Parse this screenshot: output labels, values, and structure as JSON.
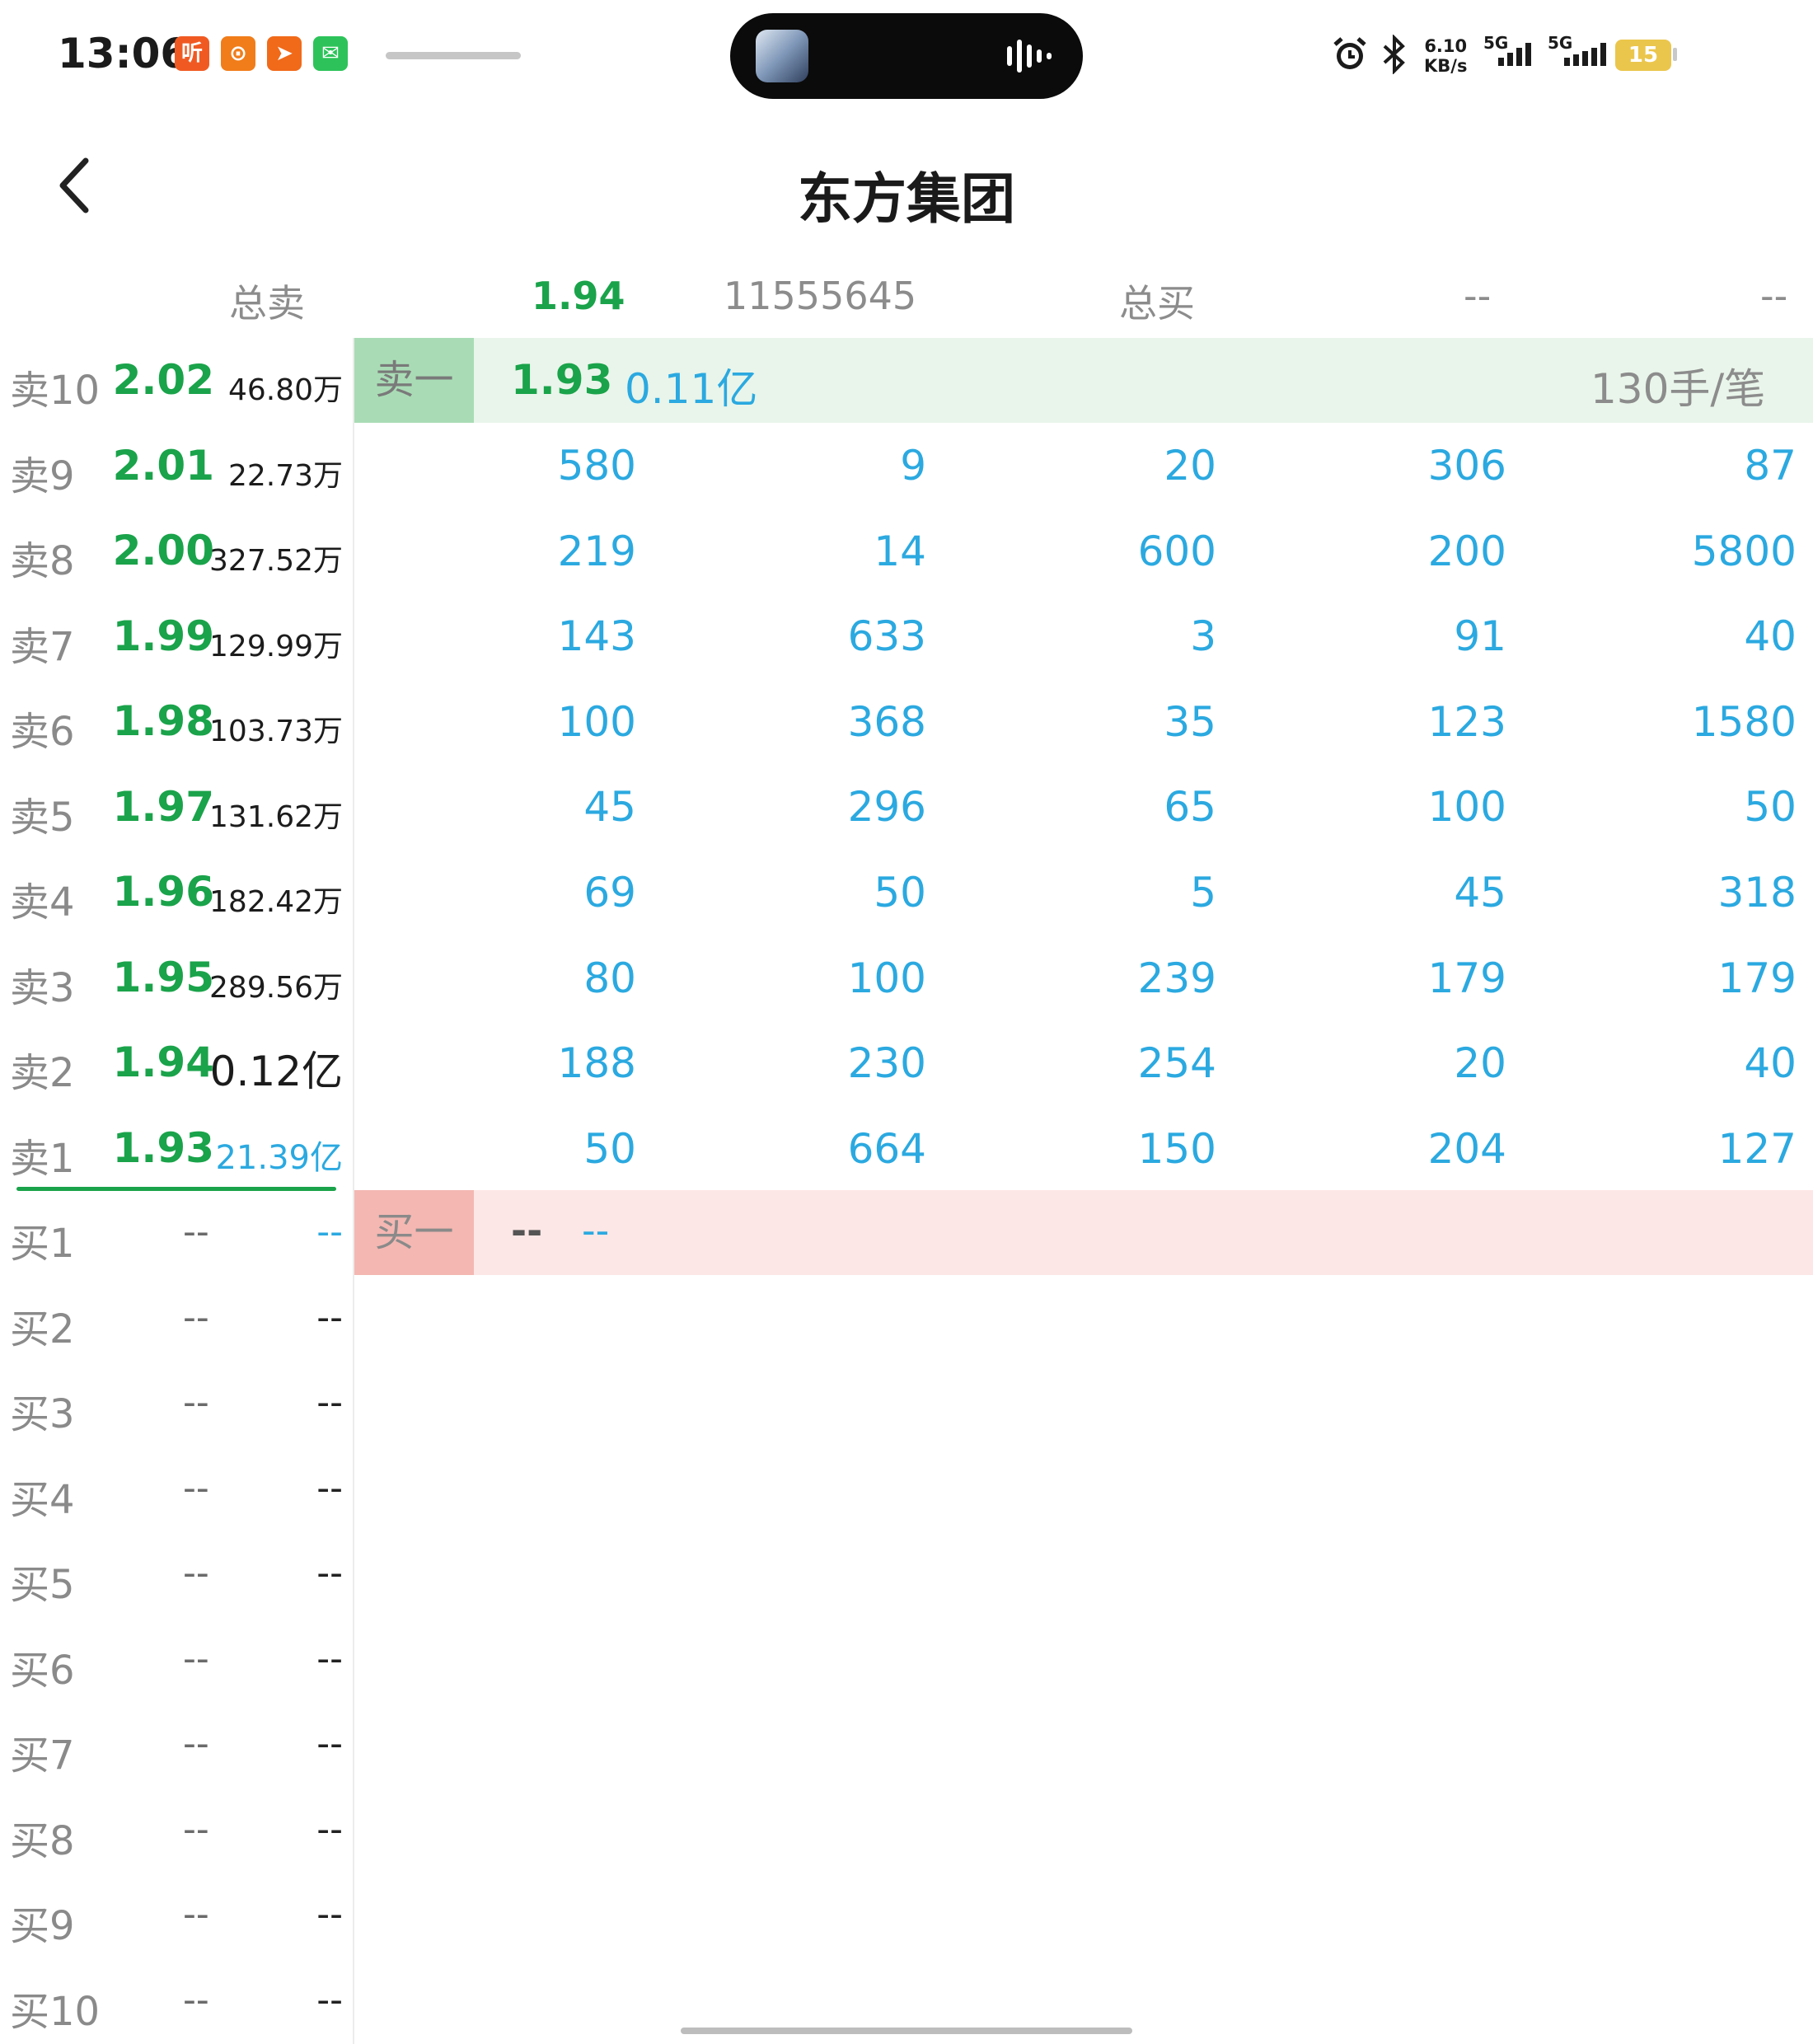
{
  "status_bar": {
    "time": "13:06",
    "apps": [
      {
        "name": "ting-app-icon",
        "glyph": "听",
        "color": "#f05a22"
      },
      {
        "name": "fund-app-icon",
        "glyph": "⊙",
        "color": "#f07d1a"
      },
      {
        "name": "paper-plane-app-icon",
        "glyph": "➤",
        "color": "#f06a1a"
      },
      {
        "name": "wechat-icon",
        "glyph": "✉",
        "color": "#2dc35a"
      }
    ],
    "speed_value": "6.10",
    "speed_unit": "KB/s",
    "sim1": "5G",
    "sim2": "5G",
    "battery": "15"
  },
  "header": {
    "title": "东方集团"
  },
  "summary": {
    "sell_label": "总卖",
    "sell_price": "1.94",
    "sell_volume": "11555645",
    "buy_label": "总买",
    "buy_price": "--",
    "buy_volume": "--"
  },
  "sell_levels": [
    {
      "label": "卖10",
      "price": "2.02",
      "volume": "46.80万"
    },
    {
      "label": "卖9",
      "price": "2.01",
      "volume": "22.73万"
    },
    {
      "label": "卖8",
      "price": "2.00",
      "volume": "327.52万"
    },
    {
      "label": "卖7",
      "price": "1.99",
      "volume": "129.99万"
    },
    {
      "label": "卖6",
      "price": "1.98",
      "volume": "103.73万"
    },
    {
      "label": "卖5",
      "price": "1.97",
      "volume": "131.62万"
    },
    {
      "label": "卖4",
      "price": "1.96",
      "volume": "182.42万"
    },
    {
      "label": "卖3",
      "price": "1.95",
      "volume": "289.56万"
    },
    {
      "label": "卖2",
      "price": "1.94",
      "volume": "0.12亿"
    },
    {
      "label": "卖1",
      "price": "1.93",
      "volume": "21.39亿"
    }
  ],
  "buy_levels": [
    {
      "label": "买1",
      "price": "--",
      "volume": "--"
    },
    {
      "label": "买2",
      "price": "--",
      "volume": "--"
    },
    {
      "label": "买3",
      "price": "--",
      "volume": "--"
    },
    {
      "label": "买4",
      "price": "--",
      "volume": "--"
    },
    {
      "label": "买5",
      "price": "--",
      "volume": "--"
    },
    {
      "label": "买6",
      "price": "--",
      "volume": "--"
    },
    {
      "label": "买7",
      "price": "--",
      "volume": "--"
    },
    {
      "label": "买8",
      "price": "--",
      "volume": "--"
    },
    {
      "label": "买9",
      "price": "--",
      "volume": "--"
    },
    {
      "label": "买10",
      "price": "--",
      "volume": "--"
    }
  ],
  "sell_one": {
    "tag": "卖一",
    "price": "1.93",
    "amount": "0.11亿",
    "per_order": "130手/笔"
  },
  "sell_one_queue": [
    [
      "580",
      "9",
      "20",
      "306",
      "87"
    ],
    [
      "219",
      "14",
      "600",
      "200",
      "5800"
    ],
    [
      "143",
      "633",
      "3",
      "91",
      "40"
    ],
    [
      "100",
      "368",
      "35",
      "123",
      "1580"
    ],
    [
      "45",
      "296",
      "65",
      "100",
      "50"
    ],
    [
      "69",
      "50",
      "5",
      "45",
      "318"
    ],
    [
      "80",
      "100",
      "239",
      "179",
      "179"
    ],
    [
      "188",
      "230",
      "254",
      "20",
      "40"
    ],
    [
      "50",
      "664",
      "150",
      "204",
      "127"
    ]
  ],
  "buy_one": {
    "tag": "买一",
    "price": "--",
    "amount": "--"
  }
}
